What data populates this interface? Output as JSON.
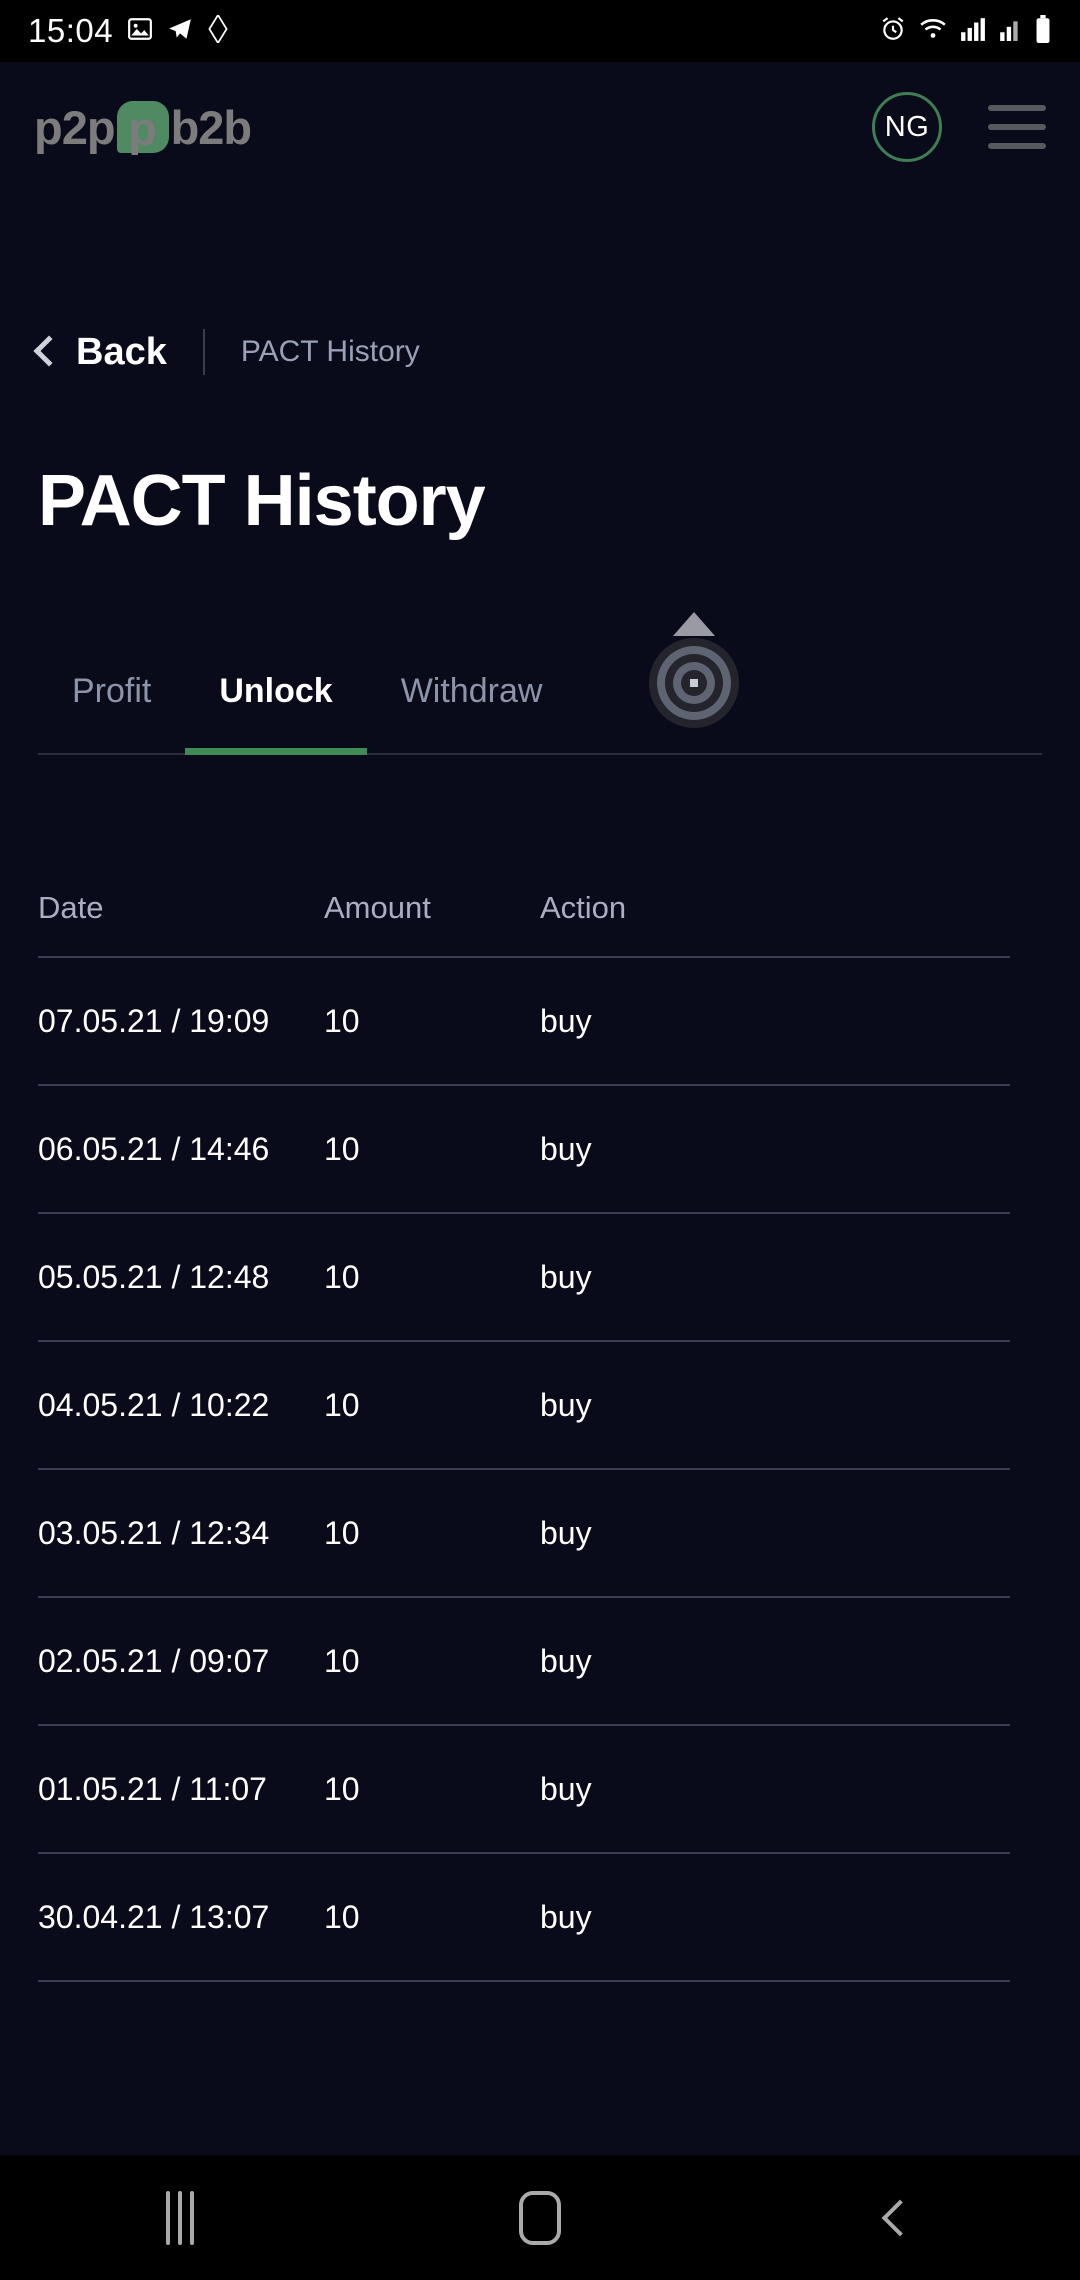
{
  "status_bar": {
    "time": "15:04",
    "left_icons": [
      "gallery-icon",
      "telegram-icon",
      "diamond-icon"
    ],
    "right_icons": [
      "alarm-icon",
      "wifi-icon",
      "signal-icon",
      "signal-2-icon",
      "battery-icon"
    ]
  },
  "app_header": {
    "logo_prefix": "p2p",
    "logo_mark_letter": "p",
    "logo_suffix": "b2b",
    "avatar_initials": "NG",
    "menu_label": "menu"
  },
  "breadcrumb": {
    "back_label": "Back",
    "current": "PACT History"
  },
  "page": {
    "title": "PACT History"
  },
  "tabs": [
    {
      "label": "Profit",
      "active": false
    },
    {
      "label": "Unlock",
      "active": true
    },
    {
      "label": "Withdraw",
      "active": false
    }
  ],
  "table": {
    "columns": [
      "Date",
      "Amount",
      "Action"
    ],
    "rows": [
      {
        "date": "07.05.21 / 19:09",
        "amount": "10",
        "action": "buy"
      },
      {
        "date": "06.05.21 / 14:46",
        "amount": "10",
        "action": "buy"
      },
      {
        "date": "05.05.21 / 12:48",
        "amount": "10",
        "action": "buy"
      },
      {
        "date": "04.05.21 / 10:22",
        "amount": "10",
        "action": "buy"
      },
      {
        "date": "03.05.21 / 12:34",
        "amount": "10",
        "action": "buy"
      },
      {
        "date": "02.05.21 / 09:07",
        "amount": "10",
        "action": "buy"
      },
      {
        "date": "01.05.21 / 11:07",
        "amount": "10",
        "action": "buy"
      },
      {
        "date": "30.04.21 / 13:07",
        "amount": "10",
        "action": "buy"
      }
    ]
  },
  "floating_widget": {
    "name": "screen-recorder-overlay"
  },
  "nav_bar": {
    "recents_label": "recents",
    "home_label": "home",
    "back_label": "back"
  },
  "colors": {
    "background": "#0a0b1a",
    "accent_green": "#3f8a55",
    "logo_green": "#4f8a63",
    "muted_text": "#8d93a8",
    "divider": "#393d55"
  }
}
